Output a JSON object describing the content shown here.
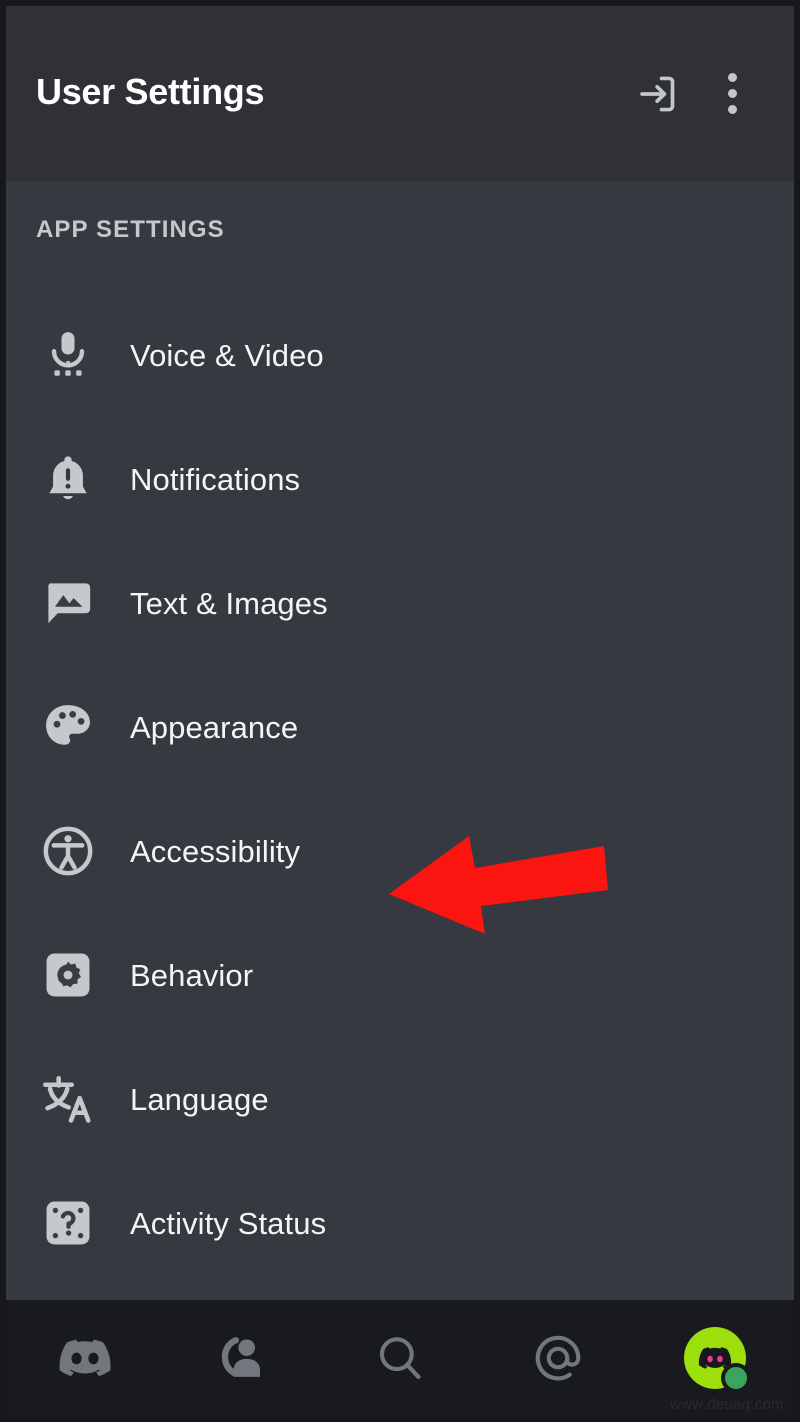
{
  "header": {
    "title": "User Settings",
    "logout_icon": "logout-icon",
    "overflow_icon": "overflow-menu-icon"
  },
  "section": {
    "label": "APP SETTINGS"
  },
  "menu": {
    "items": [
      {
        "label": "Voice & Video",
        "icon": "microphone-icon"
      },
      {
        "label": "Notifications",
        "icon": "bell-alert-icon"
      },
      {
        "label": "Text & Images",
        "icon": "chat-image-icon"
      },
      {
        "label": "Appearance",
        "icon": "palette-icon"
      },
      {
        "label": "Accessibility",
        "icon": "accessibility-icon"
      },
      {
        "label": "Behavior",
        "icon": "gear-square-icon"
      },
      {
        "label": "Language",
        "icon": "translate-icon"
      },
      {
        "label": "Activity Status",
        "icon": "question-dice-icon"
      }
    ]
  },
  "annotation": {
    "type": "arrow",
    "points_to": "Appearance",
    "color": "#fb1410"
  },
  "bottom_nav": {
    "items": [
      {
        "name": "home-discord-icon"
      },
      {
        "name": "friends-icon"
      },
      {
        "name": "search-icon"
      },
      {
        "name": "mentions-icon"
      },
      {
        "name": "user-avatar"
      }
    ],
    "status": "online"
  },
  "watermark": {
    "text": "www.deuaq.com"
  },
  "colors": {
    "header_bg": "#2f3136",
    "list_bg": "#36393f",
    "nav_bg": "#191a1d",
    "icon_gray": "#c5c8cd",
    "nav_icon_gray": "#72767d",
    "text_white": "#f4f5f6",
    "arrow_red": "#fb1410",
    "avatar_green": "#9ddf0c",
    "status_green": "#3ba55d"
  }
}
